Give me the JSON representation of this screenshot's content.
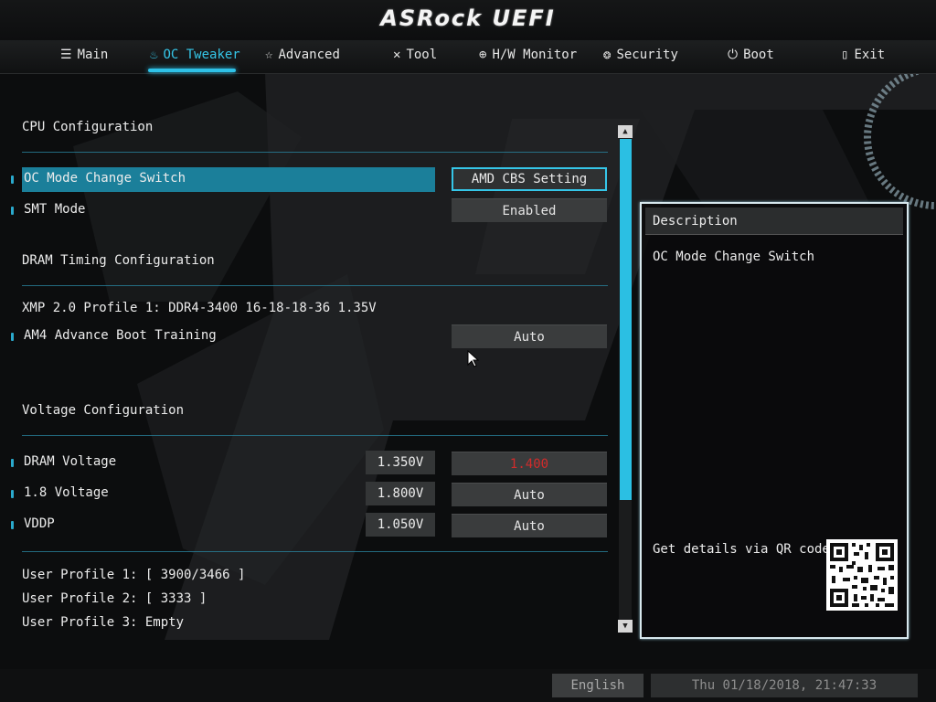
{
  "app": {
    "brand": "ASRock UEFI"
  },
  "nav": {
    "tabs": [
      {
        "label": "Main",
        "icon": "list-icon",
        "active": false
      },
      {
        "label": "OC Tweaker",
        "icon": "flame-icon",
        "active": true
      },
      {
        "label": "Advanced",
        "icon": "star-icon",
        "active": false
      },
      {
        "label": "Tool",
        "icon": "tools-icon",
        "active": false
      },
      {
        "label": "H/W Monitor",
        "icon": "crosshair-icon",
        "active": false
      },
      {
        "label": "Security",
        "icon": "shield-icon",
        "active": false
      },
      {
        "label": "Boot",
        "icon": "power-icon",
        "active": false
      },
      {
        "label": "Exit",
        "icon": "door-icon",
        "active": false
      }
    ]
  },
  "content": {
    "cpu_header": "CPU Configuration",
    "oc_mode": {
      "label": "OC Mode Change Switch",
      "value": "AMD CBS Setting"
    },
    "smt": {
      "label": "SMT Mode",
      "value": "Enabled"
    },
    "dram_header": "DRAM Timing Configuration",
    "xmp_text": "XMP 2.0 Profile 1: DDR4-3400 16-18-18-36 1.35V",
    "am4": {
      "label": "AM4 Advance Boot Training",
      "value": "Auto"
    },
    "voltage_header": "Voltage Configuration",
    "dram_voltage": {
      "label": "DRAM Voltage",
      "current": "1.350V",
      "value": "1.400"
    },
    "v18": {
      "label": "1.8 Voltage",
      "current": "1.800V",
      "value": "Auto"
    },
    "vddp": {
      "label": "VDDP",
      "current": "1.050V",
      "value": "Auto"
    },
    "profile1": "User Profile 1: [ 3900/3466 ]",
    "profile2": "User Profile 2: [ 3333 ]",
    "profile3": "User Profile 3: Empty"
  },
  "description": {
    "title": "Description",
    "text": "OC Mode Change Switch",
    "qr_text": "Get details via QR code"
  },
  "footer": {
    "language": "English",
    "datetime": "Thu 01/18/2018, 21:47:33"
  },
  "colors": {
    "accent": "#2ec2e8",
    "highlight": "#1b7f9a",
    "warning_value": "#d12b2b"
  }
}
